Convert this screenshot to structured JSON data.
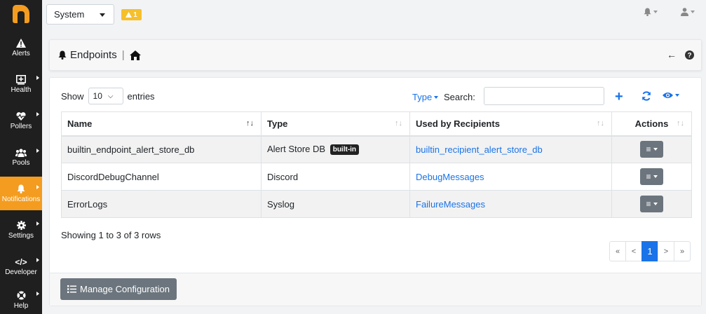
{
  "sidebar": {
    "items": [
      {
        "label": "Alerts",
        "icon": "warning-icon",
        "glyph": "▲"
      },
      {
        "label": "Health",
        "icon": "health-icon",
        "glyph": "⊞"
      },
      {
        "label": "Pollers",
        "icon": "heartbeat-icon",
        "glyph": "♥"
      },
      {
        "label": "Pools",
        "icon": "users-icon",
        "glyph": "👥"
      },
      {
        "label": "Notifications",
        "icon": "bell-icon",
        "glyph": "🔔"
      },
      {
        "label": "Settings",
        "icon": "gear-icon",
        "glyph": "⚙"
      },
      {
        "label": "Developer",
        "icon": "code-icon",
        "glyph": "</>"
      },
      {
        "label": "Help",
        "icon": "help-icon",
        "glyph": "⊗"
      }
    ]
  },
  "topbar": {
    "system_select": "System",
    "warning_count": "1"
  },
  "header": {
    "title": "Endpoints",
    "separator": "|"
  },
  "table_controls": {
    "show_label": "Show",
    "entries_value": "10",
    "entries_label": "entries",
    "type_filter": "Type",
    "search_label": "Search:",
    "search_value": ""
  },
  "table": {
    "columns": [
      "Name",
      "Type",
      "Used by Recipients",
      "Actions"
    ],
    "rows": [
      {
        "name": "builtin_endpoint_alert_store_db",
        "type": "Alert Store DB",
        "badge": "built-in",
        "recipients": "builtin_recipient_alert_store_db"
      },
      {
        "name": "DiscordDebugChannel",
        "type": "Discord",
        "badge": "",
        "recipients": "DebugMessages"
      },
      {
        "name": "ErrorLogs",
        "type": "Syslog",
        "badge": "",
        "recipients": "FailureMessages"
      }
    ]
  },
  "summary": "Showing 1 to 3 of 3 rows",
  "pagination": {
    "first": "«",
    "prev": "<",
    "current": "1",
    "next": ">",
    "last": "»"
  },
  "footer": {
    "manage_button": "Manage Configuration"
  },
  "colors": {
    "accent": "#f39c1f",
    "link": "#1a73e8",
    "sidebar_bg": "#1f1f1f",
    "warning": "#f6c02b",
    "button_gray": "#6c757d"
  }
}
